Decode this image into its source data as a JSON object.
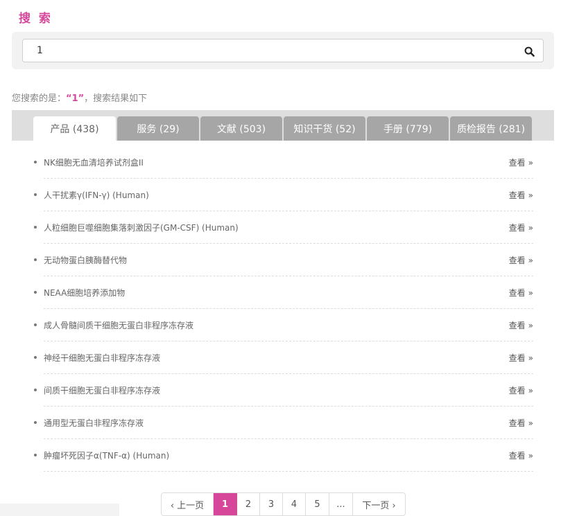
{
  "page": {
    "title": "搜 索"
  },
  "search": {
    "value": "1",
    "placeholder": ""
  },
  "summary": {
    "prefix": "您搜索的是：",
    "term_open": "“",
    "term": "1",
    "term_close": "”",
    "suffix": "，搜索结果如下"
  },
  "tabs": [
    {
      "label": "产品 (438)",
      "active": true
    },
    {
      "label": "服务 (29)",
      "active": false
    },
    {
      "label": "文献 (503)",
      "active": false
    },
    {
      "label": "知识干货 (52)",
      "active": false
    },
    {
      "label": "手册 (779)",
      "active": false
    },
    {
      "label": "质检报告 (281)",
      "active": false
    }
  ],
  "results": [
    {
      "name": "NK细胞无血清培养试剂盒II",
      "action": "查看"
    },
    {
      "name": "人干扰素γ(IFN-γ) (Human)",
      "action": "查看"
    },
    {
      "name": "人粒细胞巨噬细胞集落刺激因子(GM-CSF) (Human)",
      "action": "查看"
    },
    {
      "name": "无动物蛋白胰酶替代物",
      "action": "查看"
    },
    {
      "name": "NEAA细胞培养添加物",
      "action": "查看"
    },
    {
      "name": "成人骨髓间质干细胞无蛋白非程序冻存液",
      "action": "查看"
    },
    {
      "name": "神经干细胞无蛋白非程序冻存液",
      "action": "查看"
    },
    {
      "name": "间质干细胞无蛋白非程序冻存液",
      "action": "查看"
    },
    {
      "name": "通用型无蛋白非程序冻存液",
      "action": "查看"
    },
    {
      "name": "肿瘤坏死因子α(TNF-α) (Human)",
      "action": "查看"
    }
  ],
  "pagination": {
    "prev": "‹ 上一页",
    "pages": [
      "1",
      "2",
      "3",
      "4",
      "5"
    ],
    "current": "1",
    "ellipsis": "...",
    "next": "下一页 ›"
  },
  "colors": {
    "accent": "#d6479a",
    "tab_inactive": "#a6a6a6",
    "tab_bar": "#dedede"
  },
  "icons": {
    "search": "search-icon",
    "chevron": "double-chevron-right-icon"
  }
}
